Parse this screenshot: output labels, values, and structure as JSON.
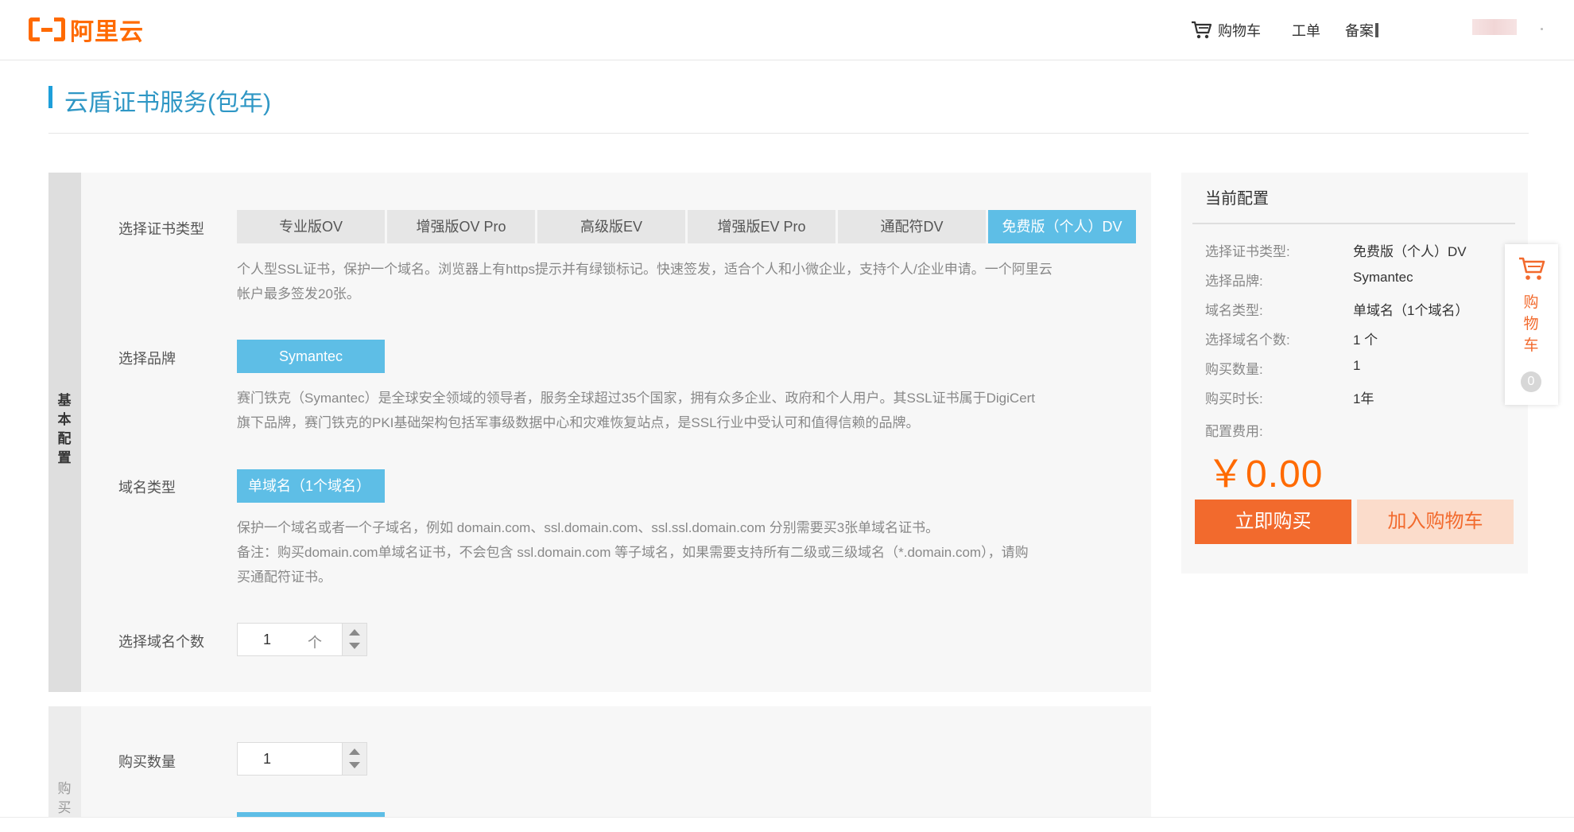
{
  "header": {
    "logo_text": "阿里云",
    "nav_cart": "购物车",
    "nav_ticket": "工单",
    "nav_record": "备案"
  },
  "page_title": "云盾证书服务(包年)",
  "basic_section": {
    "side_label": [
      "基",
      "本",
      "配",
      "置"
    ],
    "cert_type": {
      "label": "选择证书类型",
      "options": [
        "专业版OV",
        "增强版OV Pro",
        "高级版EV",
        "增强版EV Pro",
        "通配符DV",
        "免费版（个人）DV"
      ],
      "selected": "免费版（个人）DV",
      "desc_line1": "个人型SSL证书，保护一个域名。浏览器上有https提示并有绿锁标记。快速签发，适合个人和小微企业，支持个人/企业申请。一个阿里云",
      "desc_line2": "帐户最多签发20张。"
    },
    "brand": {
      "label": "选择品牌",
      "selected": "Symantec",
      "desc_line1": "赛门铁克（Symantec）是全球安全领域的领导者，服务全球超过35个国家，拥有众多企业、政府和个人用户。其SSL证书属于DigiCert",
      "desc_line2": "旗下品牌，赛门铁克的PKI基础架构包括军事级数据中心和灾难恢复站点，是SSL行业中受认可和值得信赖的品牌。"
    },
    "domain_type": {
      "label": "域名类型",
      "selected": "单域名（1个域名）",
      "desc_line1": "保护一个域名或者一个子域名，例如 domain.com、ssl.domain.com、ssl.ssl.domain.com 分别需要买3张单域名证书。",
      "desc_line2": "备注：购买domain.com单域名证书，不会包含 ssl.domain.com 等子域名，如果需要支持所有二级或三级域名（*.domain.com），请购",
      "desc_line3": "买通配符证书。"
    },
    "domain_count": {
      "label": "选择域名个数",
      "value": "1",
      "unit": "个"
    }
  },
  "purchase_section": {
    "side_label": [
      "购",
      "买"
    ],
    "quantity": {
      "label": "购买数量",
      "value": "1"
    }
  },
  "summary": {
    "title": "当前配置",
    "rows": [
      {
        "label": "选择证书类型:",
        "value": "免费版（个人）DV"
      },
      {
        "label": "选择品牌:",
        "value": "Symantec"
      },
      {
        "label": "域名类型:",
        "value": "单域名（1个域名）"
      },
      {
        "label": "选择域名个数:",
        "value": "1 个"
      },
      {
        "label": "购买数量:",
        "value": "1"
      },
      {
        "label": "购买时长:",
        "value": "1年"
      }
    ],
    "fee_label": "配置费用:",
    "price": "￥0.00",
    "buy_now": "立即购买",
    "add_to_cart": "加入购物车"
  },
  "float_cart": {
    "chars": [
      "购",
      "物",
      "车"
    ],
    "count": "0"
  },
  "colors": {
    "brand_orange": "#ff6a00",
    "accent_blue": "#5ebee6",
    "title_blue": "#2f97c5",
    "buy_orange": "#f26a2d"
  }
}
